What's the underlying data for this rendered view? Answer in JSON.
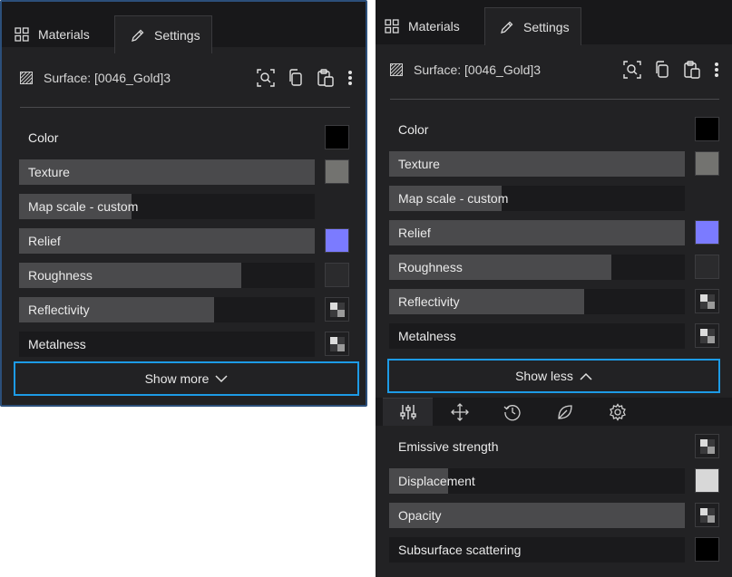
{
  "left": {
    "tabs": [
      {
        "label": "Materials",
        "icon": "grid-icon"
      },
      {
        "label": "Settings",
        "icon": "pencil-icon"
      }
    ],
    "surface": {
      "label": "Surface: [0046_Gold]3"
    },
    "properties": [
      {
        "label": "Color",
        "fill": 0,
        "swatch": "#000000"
      },
      {
        "label": "Texture",
        "fill": 1.0,
        "swatch": "#737370"
      },
      {
        "label": "Map scale - custom",
        "fill": 0.38,
        "swatch": null
      },
      {
        "label": "Relief",
        "fill": 1.0,
        "swatch": "#7b7bff"
      },
      {
        "label": "Roughness",
        "fill": 0.75,
        "swatch": "#2b2b2d"
      },
      {
        "label": "Reflectivity",
        "fill": 0.66,
        "swatch": "checker"
      },
      {
        "label": "Metalness",
        "fill": 0.0,
        "swatch": "checker"
      }
    ],
    "show_more": {
      "label": "Show more"
    }
  },
  "right": {
    "tabs": [
      {
        "label": "Materials",
        "icon": "grid-icon"
      },
      {
        "label": "Settings",
        "icon": "pencil-icon"
      }
    ],
    "surface": {
      "label": "Surface: [0046_Gold]3"
    },
    "properties": [
      {
        "label": "Color",
        "fill": 0,
        "swatch": "#000000"
      },
      {
        "label": "Texture",
        "fill": 1.0,
        "swatch": "#737370"
      },
      {
        "label": "Map scale - custom",
        "fill": 0.38,
        "swatch": null
      },
      {
        "label": "Relief",
        "fill": 1.0,
        "swatch": "#7b7bff"
      },
      {
        "label": "Roughness",
        "fill": 0.75,
        "swatch": "#2b2b2d"
      },
      {
        "label": "Reflectivity",
        "fill": 0.66,
        "swatch": "checker"
      },
      {
        "label": "Metalness",
        "fill": 0.0,
        "swatch": "checker"
      }
    ],
    "show_less": {
      "label": "Show less"
    },
    "icon_tabs": [
      "sliders-icon",
      "move-icon",
      "history-icon",
      "leaf-icon",
      "gear-icon"
    ],
    "extra_properties": [
      {
        "label": "Emissive strength",
        "fill": 0.0,
        "swatch": "checker"
      },
      {
        "label": "Displacement",
        "fill": 0.2,
        "swatch": "#d8d8d8"
      },
      {
        "label": "Opacity",
        "fill": 1.0,
        "swatch": "checker"
      },
      {
        "label": "Subsurface scattering",
        "fill": 0.0,
        "swatch": "#000000"
      }
    ]
  },
  "colors": {
    "panel_bg": "#222224",
    "tab_bar_bg": "#18181a",
    "bar_track": "#1a1a1c",
    "bar_fill": "#4a4a4c",
    "focus_outline": "#1d9be6",
    "selection_border": "#2c4f7a"
  }
}
